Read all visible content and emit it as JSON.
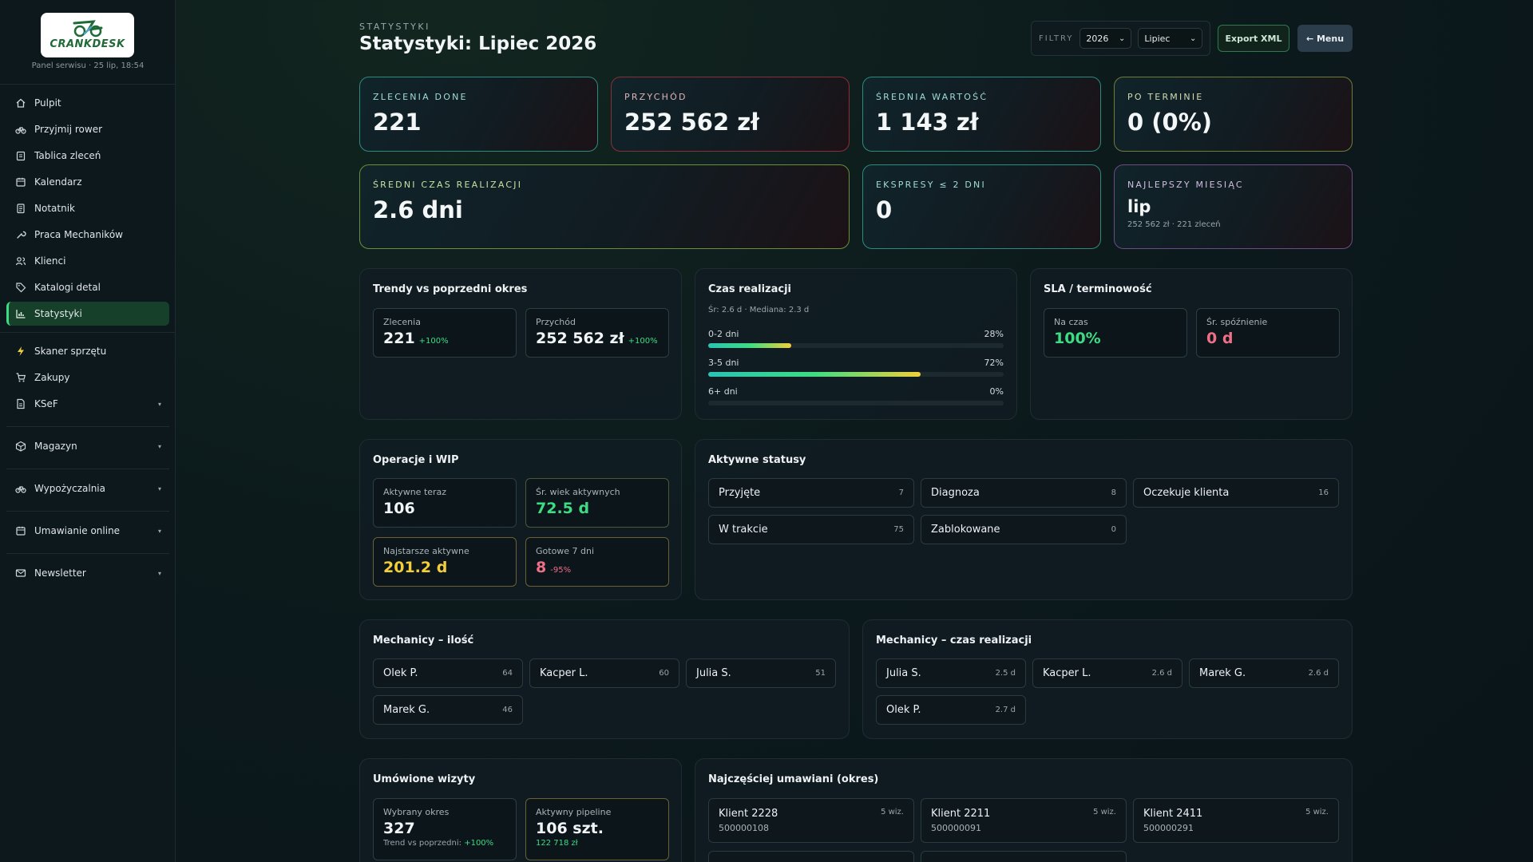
{
  "app": {
    "logo_text": "CRANKDESK",
    "panel_meta": "Panel serwisu · 25 lip, 18:54"
  },
  "sidebar": {
    "items": [
      {
        "label": "Pulpit",
        "icon": "home-icon"
      },
      {
        "label": "Przyjmij rower",
        "icon": "bike-icon"
      },
      {
        "label": "Tablica zleceń",
        "icon": "clipboard-icon"
      },
      {
        "label": "Kalendarz",
        "icon": "calendar-icon"
      },
      {
        "label": "Notatnik",
        "icon": "notepad-icon"
      },
      {
        "label": "Praca Mechaników",
        "icon": "wrench-icon"
      },
      {
        "label": "Klienci",
        "icon": "users-icon"
      },
      {
        "label": "Katalogi detal",
        "icon": "tag-icon"
      },
      {
        "label": "Statystyki",
        "icon": "chart-icon",
        "active": true
      }
    ],
    "items2": [
      {
        "label": "Skaner sprzętu",
        "icon": "lightning-icon"
      },
      {
        "label": "Zakupy",
        "icon": "cart-icon"
      },
      {
        "label": "KSeF",
        "icon": "document-icon",
        "chevron": "▾"
      }
    ],
    "groups": [
      {
        "label": "Magazyn",
        "icon": "box-icon",
        "chevron": "▾"
      },
      {
        "label": "Wypożyczalnia",
        "icon": "bike-icon",
        "chevron": "▾"
      },
      {
        "label": "Umawianie online",
        "icon": "calendar-icon",
        "chevron": "▾"
      },
      {
        "label": "Newsletter",
        "icon": "mail-icon",
        "chevron": "▾"
      }
    ]
  },
  "header": {
    "crumb": "STATYSTYKI",
    "title": "Statystyki: Lipiec 2026",
    "filters_label": "FILTRY",
    "year": "2026",
    "month": "Lipiec",
    "export_label": "Export XML",
    "menu_label": "← Menu"
  },
  "kpis": {
    "done": {
      "label": "ZLECENIA DONE",
      "value": "221"
    },
    "revenue": {
      "label": "PRZYCHÓD",
      "value": "252 562 zł"
    },
    "avg_value": {
      "label": "ŚREDNIA WARTOŚĆ",
      "value": "1 143 zł"
    },
    "overdue": {
      "label": "PO TERMINIE",
      "value": "0 (0%)"
    },
    "avg_time": {
      "label": "ŚREDNI CZAS REALIZACJI",
      "value": "2.6 dni"
    },
    "express": {
      "label": "EKSPRESY ≤ 2 DNI",
      "value": "0"
    },
    "best_month": {
      "label": "NAJLEPSZY MIESIĄC",
      "value": "lip",
      "sub": "252 562 zł · 221 zleceń"
    }
  },
  "trends": {
    "title": "Trendy vs poprzedni okres",
    "orders": {
      "label": "Zlecenia",
      "value": "221",
      "delta": "+100%"
    },
    "revenue": {
      "label": "Przychód",
      "value": "252 562 zł",
      "delta": "+100%"
    }
  },
  "lead_time": {
    "title": "Czas realizacji",
    "summary": "Śr: 2.6 d · Mediana: 2.3 d",
    "bars": [
      {
        "label": "0-2 dni",
        "pct_label": "28%",
        "pct": 28
      },
      {
        "label": "3-5 dni",
        "pct_label": "72%",
        "pct": 72
      },
      {
        "label": "6+ dni",
        "pct_label": "0%",
        "pct": 0
      }
    ]
  },
  "sla": {
    "title": "SLA / terminowość",
    "on_time": {
      "label": "Na czas",
      "value": "100%"
    },
    "avg_delay": {
      "label": "Śr. spóźnienie",
      "value": "0 d"
    }
  },
  "ops": {
    "title": "Operacje i WIP",
    "active_now": {
      "label": "Aktywne teraz",
      "value": "106"
    },
    "avg_age": {
      "label": "Śr. wiek aktywnych",
      "value": "72.5 d"
    },
    "oldest": {
      "label": "Najstarsze aktywne",
      "value": "201.2 d"
    },
    "ready7": {
      "label": "Gotowe 7 dni",
      "value": "8",
      "delta": "-95%"
    }
  },
  "statuses": {
    "title": "Aktywne statusy",
    "items": [
      {
        "label": "Przyjęte",
        "count": "7"
      },
      {
        "label": "Diagnoza",
        "count": "8"
      },
      {
        "label": "Oczekuje klienta",
        "count": "16"
      },
      {
        "label": "W trakcie",
        "count": "75"
      },
      {
        "label": "Zablokowane",
        "count": "0"
      }
    ]
  },
  "mech_count": {
    "title": "Mechanicy – ilość",
    "items": [
      {
        "label": "Olek P.",
        "count": "64"
      },
      {
        "label": "Kacper L.",
        "count": "60"
      },
      {
        "label": "Julia S.",
        "count": "51"
      },
      {
        "label": "Marek G.",
        "count": "46"
      }
    ]
  },
  "mech_time": {
    "title": "Mechanicy – czas realizacji",
    "items": [
      {
        "label": "Julia S.",
        "count": "2.5 d"
      },
      {
        "label": "Kacper L.",
        "count": "2.6 d"
      },
      {
        "label": "Marek G.",
        "count": "2.6 d"
      },
      {
        "label": "Olek P.",
        "count": "2.7 d"
      }
    ]
  },
  "visits": {
    "title": "Umówione wizyty",
    "period": {
      "label": "Wybrany okres",
      "value": "327",
      "foot_prefix": "Trend vs poprzedni: ",
      "foot_delta": "+100%"
    },
    "pipeline": {
      "label": "Aktywny pipeline",
      "value": "106 szt.",
      "foot": "122 718 zł"
    }
  },
  "frequent": {
    "title": "Najczęściej umawiani (okres)",
    "items": [
      {
        "name": "Klient 2228",
        "count": "5 wiz.",
        "phone": "500000108"
      },
      {
        "name": "Klient 2211",
        "count": "5 wiz.",
        "phone": "500000091"
      },
      {
        "name": "Klient 2411",
        "count": "5 wiz.",
        "phone": "500000291"
      }
    ]
  },
  "colors": {
    "accent_green": "#3ddc84",
    "accent_yellow": "#f2cf3a",
    "accent_pink": "#ef6f86",
    "active_nav_bg": "#17402b"
  }
}
